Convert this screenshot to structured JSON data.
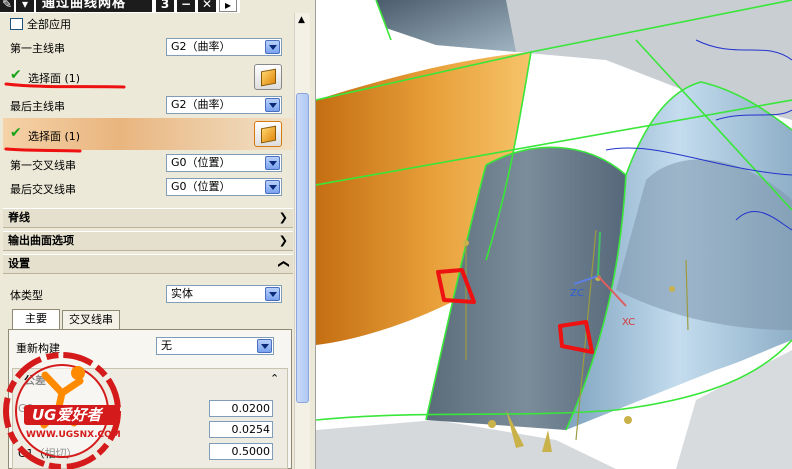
{
  "dialog": {
    "title": "通过曲线网格",
    "title_icon_prefix": "✎",
    "title_icon_number": "3",
    "title_minus": "−",
    "title_close": "✕",
    "title_more": "▸",
    "apply_all_label": "全部应用",
    "primary_first": {
      "label": "第一主线串",
      "value": "G2（曲率）"
    },
    "primary_first_face": "选择面 (1)",
    "primary_last": {
      "label": "最后主线串",
      "value": "G2（曲率）"
    },
    "primary_last_face": "选择面 (1)",
    "cross_first": {
      "label": "第一交叉线串",
      "value": "G0（位置）"
    },
    "cross_last": {
      "label": "最后交叉线串",
      "value": "G0（位置）"
    },
    "section_spine": "脊线",
    "section_output": "输出曲面选项",
    "section_settings": "设置",
    "body_type": {
      "label": "体类型",
      "value": "实体"
    },
    "tabs": [
      "主要",
      "交叉线串"
    ],
    "rebuild": {
      "label": "重新构建",
      "value": "无"
    },
    "tolerance_header": "公差",
    "tol_g0_label": "G0",
    "tol_g0": "0.0200",
    "tol_g1": "0.0254",
    "tol_g1_label": "G1（相切）",
    "tol_g2": "0.5000"
  },
  "viewport": {
    "axis_zc": "ZC",
    "axis_xc": "XC"
  },
  "watermark": {
    "brand": "UG爱好者",
    "url": "WWW.UGSNX.COM"
  },
  "colors": {
    "panel_bg": "#ece9d8",
    "surface_orange": "#e0962a",
    "surface_gray": "#6a7d8c",
    "edge_green": "#39e639",
    "annotation_red": "#ee1111"
  }
}
